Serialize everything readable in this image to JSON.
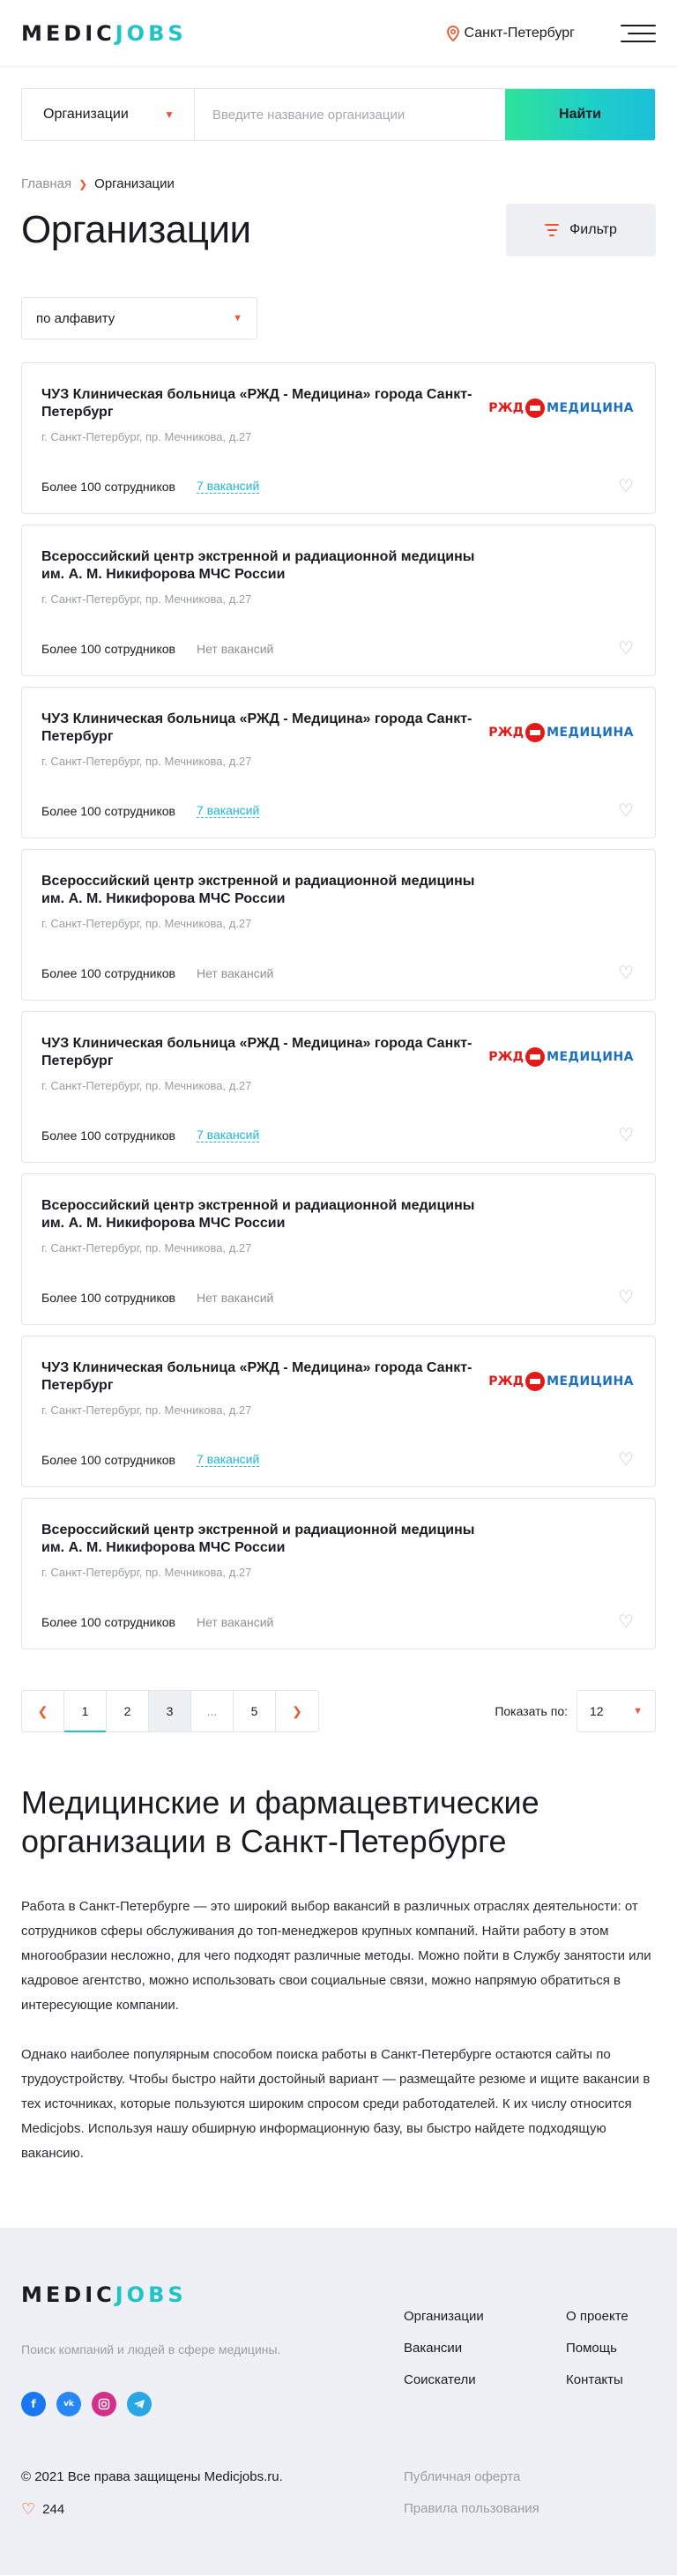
{
  "header": {
    "logo_part1": "MEDIC",
    "logo_part2": "JOBS",
    "city": "Санкт-Петербург",
    "pin_icon": "map-pin-icon",
    "menu_icon": "burger-menu-icon"
  },
  "search": {
    "select_value": "Организации",
    "placeholder": "Введите название организации",
    "button_label": "Найти"
  },
  "breadcrumb": {
    "home": "Главная",
    "current": "Организации"
  },
  "page": {
    "title": "Организации",
    "filter_label": "Фильтр",
    "sort_value": "по алфавиту"
  },
  "organizations": [
    {
      "name": "ЧУЗ Клиническая больница «РЖД - Медицина» города Санкт-Петербург",
      "address": "г. Санкт-Петербург, пр. Мечникова, д.27",
      "staff": "Более 100 сотрудников",
      "vacancies": "7 вакансий",
      "has_logo": true
    },
    {
      "name": "Всероссийский центр экстренной и радиационной медицины им. А. М. Никифорова МЧС России",
      "address": "г. Санкт-Петербург, пр. Мечникова, д.27",
      "staff": "Более 100 сотрудников",
      "vacancies": "Нет вакансий",
      "has_logo": false
    },
    {
      "name": "ЧУЗ Клиническая больница «РЖД - Медицина» города Санкт-Петербург",
      "address": "г. Санкт-Петербург, пр. Мечникова, д.27",
      "staff": "Более 100 сотрудников",
      "vacancies": "7 вакансий",
      "has_logo": true
    },
    {
      "name": "Всероссийский центр экстренной и радиационной медицины им. А. М. Никифорова МЧС России",
      "address": "г. Санкт-Петербург, пр. Мечникова, д.27",
      "staff": "Более 100 сотрудников",
      "vacancies": "Нет вакансий",
      "has_logo": false
    },
    {
      "name": "ЧУЗ Клиническая больница «РЖД - Медицина» города Санкт-Петербург",
      "address": "г. Санкт-Петербург, пр. Мечникова, д.27",
      "staff": "Более 100 сотрудников",
      "vacancies": "7 вакансий",
      "has_logo": true
    },
    {
      "name": "Всероссийский центр экстренной и радиационной медицины им. А. М. Никифорова МЧС России",
      "address": "г. Санкт-Петербург, пр. Мечникова, д.27",
      "staff": "Более 100 сотрудников",
      "vacancies": "Нет вакансий",
      "has_logo": false
    },
    {
      "name": "ЧУЗ Клиническая больница «РЖД - Медицина» города Санкт-Петербург",
      "address": "г. Санкт-Петербург, пр. Мечникова, д.27",
      "staff": "Более 100 сотрудников",
      "vacancies": "7 вакансий",
      "has_logo": true
    },
    {
      "name": "Всероссийский центр экстренной и радиационной медицины им. А. М. Никифорова МЧС России",
      "address": "г. Санкт-Петербург, пр. Мечникова, д.27",
      "staff": "Более 100 сотрудников",
      "vacancies": "Нет вакансий",
      "has_logo": false
    }
  ],
  "logo_rzd": {
    "part1": "РЖД",
    "part2": "МЕДИЦИНА"
  },
  "pagination": {
    "prev_icon": "chevron-left-icon",
    "next_icon": "chevron-right-icon",
    "pages": [
      "1",
      "2",
      "3",
      "...",
      "5"
    ],
    "active_page": "1",
    "show_label": "Показать по:",
    "show_value": "12"
  },
  "seo": {
    "title": "Медицинские и фармацевтические организации в Санкт-Петербурге",
    "paragraph1": "Работа в Санкт-Петербурге — это широкий выбор вакансий в различных отраслях деятельности: от сотрудников сферы обслуживания до топ-менеджеров крупных компаний. Найти работу в этом многообразии несложно, для чего подходят различные методы. Можно пойти в Службу занятости или кадровое агентство, можно использовать свои социальные связи, можно напрямую обратиться в интересующие компании.",
    "paragraph2": "Однако наиболее популярным способом поиска работы в Санкт-Петербурге остаются сайты по трудоустройству. Чтобы быстро найти достойный вариант — размещайте резюме и ищите вакансии в тех источниках, которые пользуются широким спросом среди работодателей. К их числу относится Medicjobs. Используя нашу обширную информационную базу, вы быстро найдете подходящую вакансию."
  },
  "footer": {
    "logo_part1": "MEDIC",
    "logo_part2": "JOBS",
    "description": "Поиск компаний и людей в сфере медицины.",
    "socials": [
      "facebook-icon",
      "vk-icon",
      "instagram-icon",
      "telegram-icon"
    ],
    "col1": [
      "Организации",
      "Вакансии",
      "Соискатели"
    ],
    "col2": [
      "О проекте",
      "Помощь",
      "Контакты"
    ],
    "copyright": "© 2021 Все права защищены Medicjobs.ru.",
    "likes": "244",
    "legal": [
      "Публичная оферта",
      "Правила пользования"
    ]
  },
  "colors": {
    "accent_orange": "#f0542c",
    "accent_teal": "#21c3c6",
    "link_blue": "#21b6d8",
    "footer_bg": "#eef0f5"
  }
}
